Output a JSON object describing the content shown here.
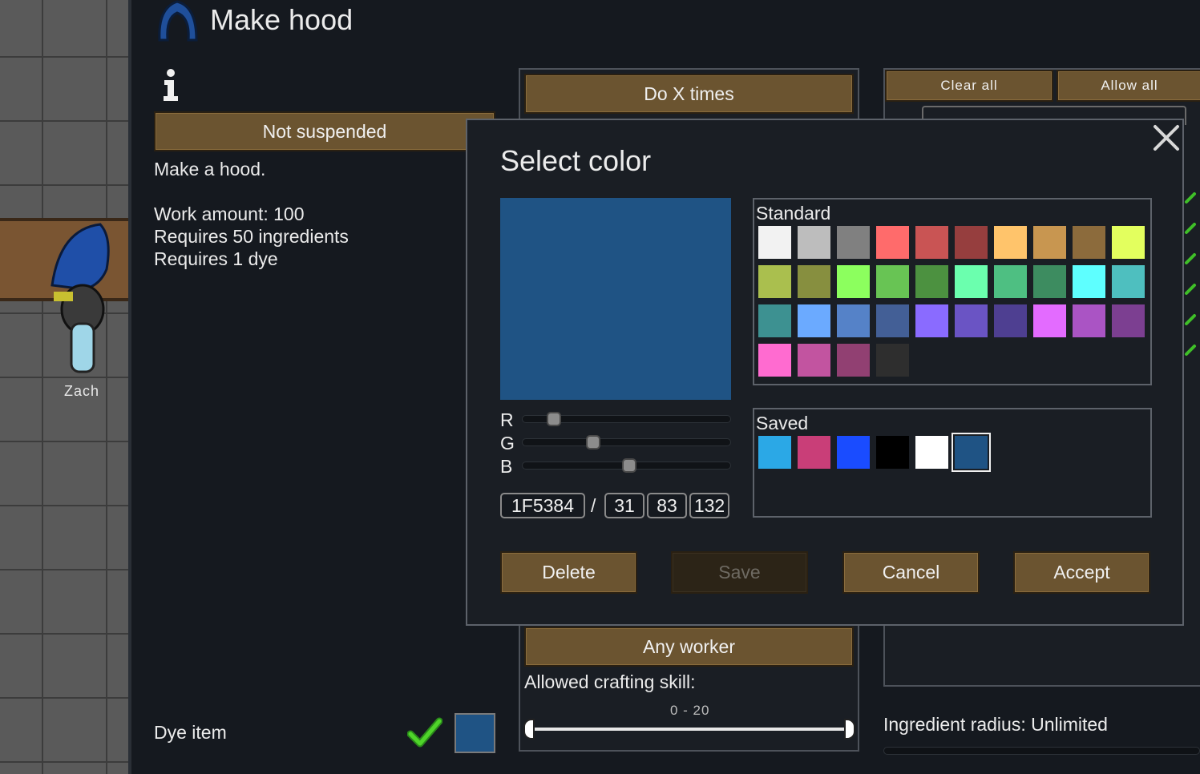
{
  "header": {
    "title": "Make hood"
  },
  "pawn": {
    "name": "Zach"
  },
  "left_panel": {
    "suspend_button": "Not suspended",
    "description": "Make a hood.",
    "info_lines": [
      "Work amount: 100",
      "Requires 50 ingredients",
      "Requires 1 dye"
    ],
    "dye_item_label": "Dye item",
    "dye_item_checked": true,
    "dye_color": "#1F5384"
  },
  "middle_panel": {
    "repeat_button": "Do X times",
    "worker_button": "Any worker",
    "skill_label": "Allowed crafting skill:",
    "skill_range": "0 - 20"
  },
  "right_panel": {
    "clear_all": "Clear all",
    "allow_all": "Allow all",
    "ingredient_radius": "Ingredient radius: Unlimited"
  },
  "dialog": {
    "title": "Select color",
    "preview_color": "#1F5384",
    "standard_label": "Standard",
    "saved_label": "Saved",
    "channels": [
      {
        "label": "R",
        "value": 31
      },
      {
        "label": "G",
        "value": 83
      },
      {
        "label": "B",
        "value": 132
      }
    ],
    "hex_value": "1F5384",
    "separator": "/",
    "r_value": "31",
    "g_value": "83",
    "b_value": "132",
    "standard_colors": [
      "#F2F2F2",
      "#BDBDBD",
      "#808080",
      "#FF6B6B",
      "#C95454",
      "#963E3E",
      "#FFC46B",
      "#C89650",
      "#8C6B3C",
      "#E3FF5E",
      "#AABF4E",
      "#878F3F",
      "#8CFF5E",
      "#68C454",
      "#4C9140",
      "#6BFFAE",
      "#4EBF82",
      "#3D8C60",
      "#5EFFFF",
      "#4EBFBF",
      "#3D9191",
      "#6BAAFF",
      "#5582C8",
      "#435F96",
      "#8A6BFF",
      "#6A54C4",
      "#4E3F91",
      "#E36BFF",
      "#AA54C4",
      "#7C3F91",
      "#FF6BD0",
      "#C254A0",
      "#914072",
      "#2E2E2E"
    ],
    "saved_colors": [
      "#2BA8E6",
      "#C93E78",
      "#1A4CFF",
      "#000000",
      "#FFFFFF",
      "#1F5384"
    ],
    "buttons": {
      "delete": "Delete",
      "save": "Save",
      "cancel": "Cancel",
      "accept": "Accept"
    }
  }
}
